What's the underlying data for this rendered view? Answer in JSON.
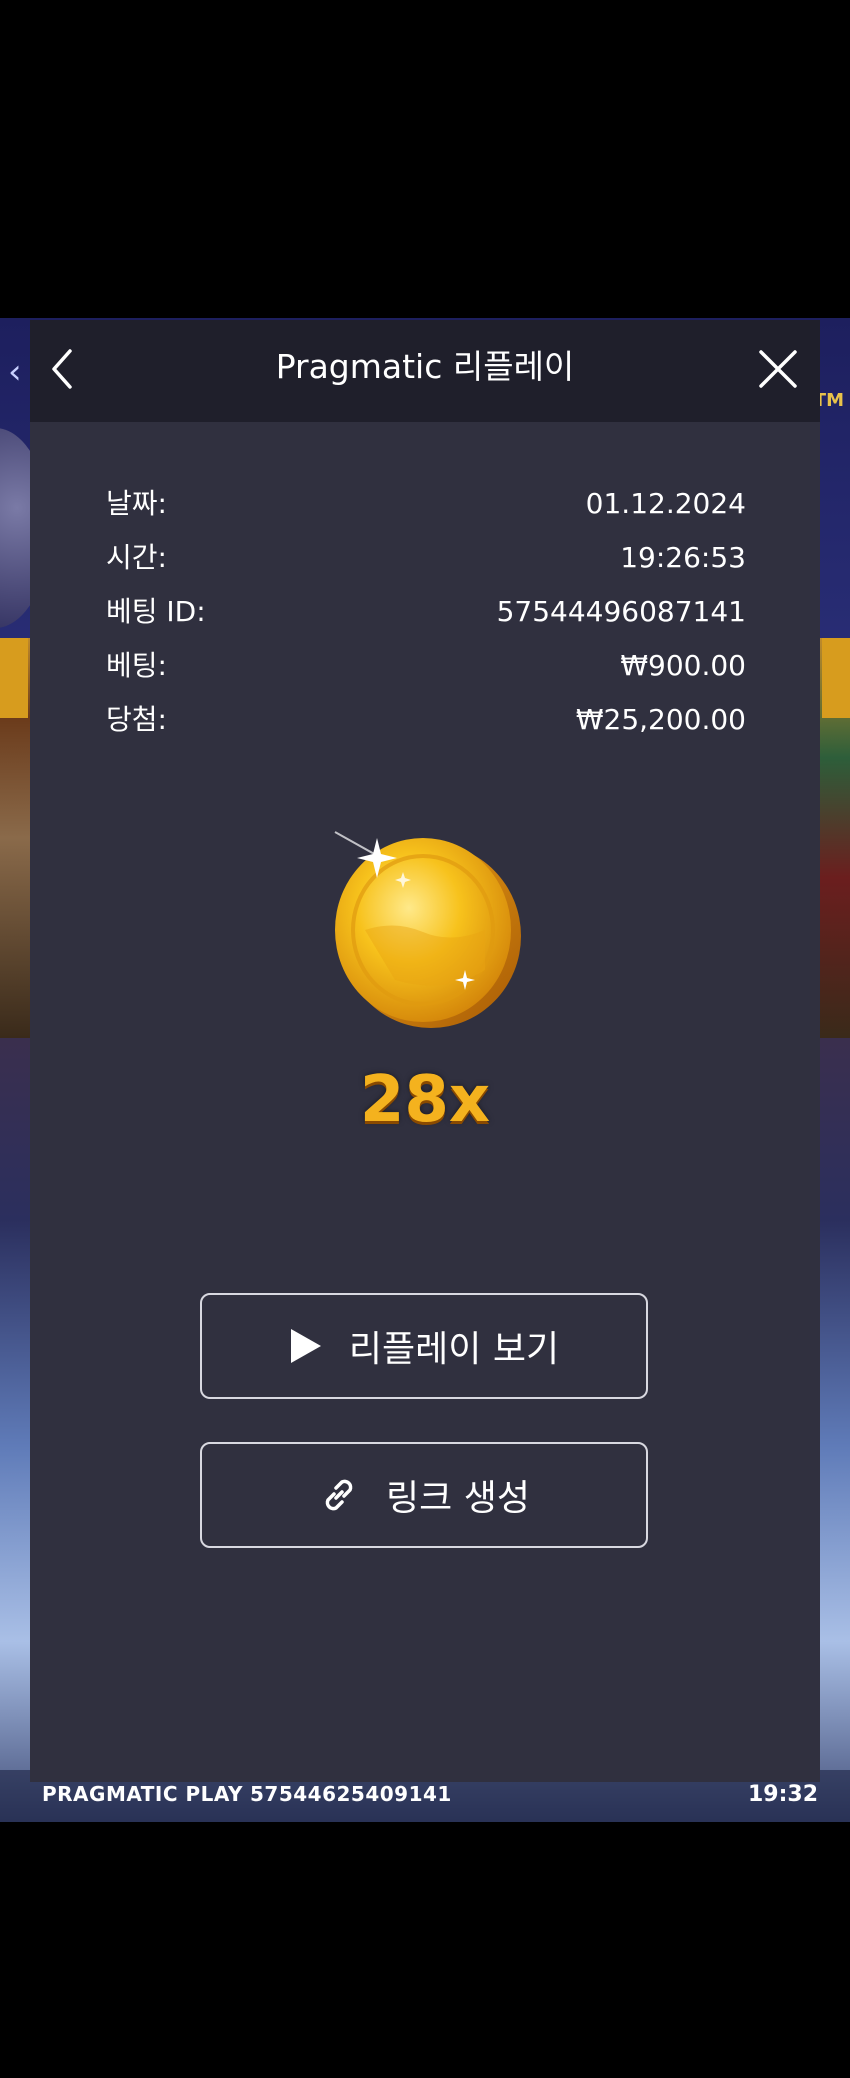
{
  "modal": {
    "title": "Pragmatic 리플레이",
    "details": [
      {
        "label": "날짜:",
        "value": "01.12.2024"
      },
      {
        "label": "시간:",
        "value": "19:26:53"
      },
      {
        "label": "베팅 ID:",
        "value": "57544496087141"
      },
      {
        "label": "베팅:",
        "value": "₩900.00"
      },
      {
        "label": "당첨:",
        "value": "₩25,200.00"
      }
    ],
    "multiplier": "28x",
    "buttons": {
      "replay_label": "리플레이 보기",
      "link_label": "링크 생성"
    }
  },
  "background": {
    "brand": "PRAGMATIC PLAY",
    "round_id": "57544625409141",
    "clock": "19:32",
    "corner_badge": "TM"
  },
  "icons": {
    "back": "chevron-left-icon",
    "close": "close-icon",
    "coin": "gold-coin-icon",
    "play": "play-icon",
    "link": "link-icon"
  },
  "colors": {
    "modal_bg": "#30303f",
    "header_bg": "#1f1f2b",
    "multiplier": "#f4b21e",
    "text": "#ffffff"
  }
}
